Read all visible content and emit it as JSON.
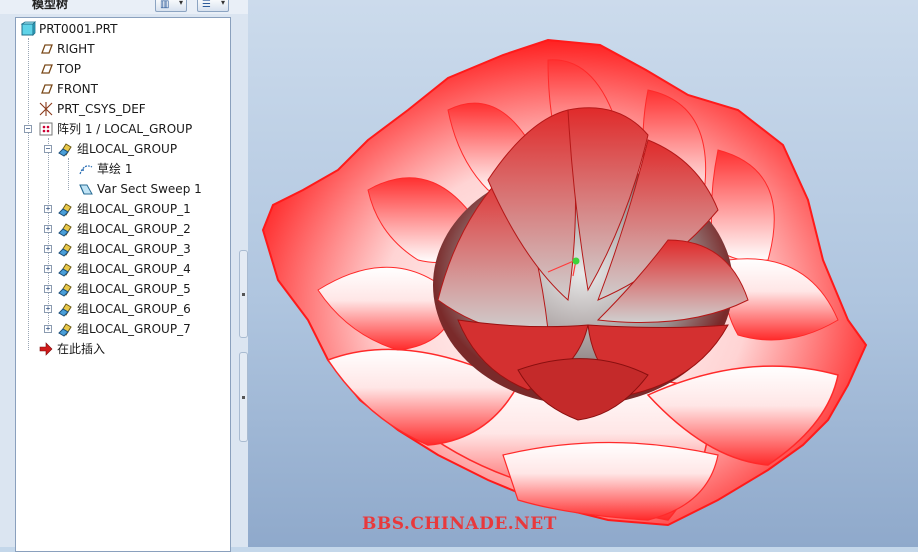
{
  "panel": {
    "title": "模型树",
    "tools": [
      {
        "icon": "show-columns-icon"
      },
      {
        "icon": "settings-list-icon"
      }
    ]
  },
  "tree": {
    "items": [
      {
        "label": "PRT0001.PRT",
        "icon": "part-icon"
      },
      {
        "label": "RIGHT",
        "icon": "datum-plane-icon"
      },
      {
        "label": "TOP",
        "icon": "datum-plane-icon"
      },
      {
        "label": "FRONT",
        "icon": "datum-plane-icon"
      },
      {
        "label": "PRT_CSYS_DEF",
        "icon": "coordinate-system-icon"
      },
      {
        "label": "阵列 1 / LOCAL_GROUP",
        "icon": "pattern-icon"
      },
      {
        "label": "组LOCAL_GROUP",
        "icon": "group-icon"
      },
      {
        "label": "草绘 1",
        "icon": "sketch-icon"
      },
      {
        "label": "Var Sect Sweep 1",
        "icon": "sweep-icon"
      },
      {
        "label": "组LOCAL_GROUP_1",
        "icon": "group-icon"
      },
      {
        "label": "组LOCAL_GROUP_2",
        "icon": "group-icon"
      },
      {
        "label": "组LOCAL_GROUP_3",
        "icon": "group-icon"
      },
      {
        "label": "组LOCAL_GROUP_4",
        "icon": "group-icon"
      },
      {
        "label": "组LOCAL_GROUP_5",
        "icon": "group-icon"
      },
      {
        "label": "组LOCAL_GROUP_6",
        "icon": "group-icon"
      },
      {
        "label": "组LOCAL_GROUP_7",
        "icon": "group-icon"
      },
      {
        "label": "在此插入",
        "icon": "insert-here-arrow-icon"
      }
    ]
  },
  "viewport": {
    "model": "flower-model-render",
    "watermark": "BBS.CHINADE.NET",
    "colors": {
      "petal": "#ff2a2a",
      "petal_light": "#ffffff",
      "background": "#b5c9e0",
      "watermark": "#e8393c"
    }
  }
}
